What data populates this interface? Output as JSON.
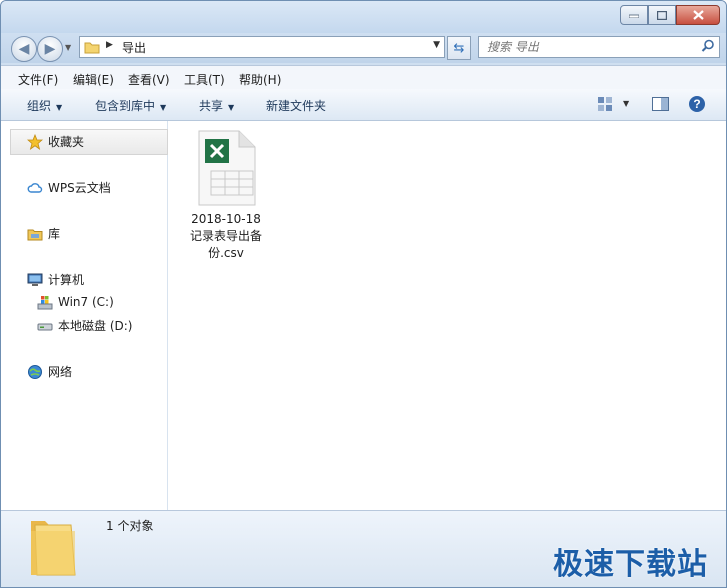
{
  "address": {
    "path": "导出"
  },
  "search": {
    "placeholder": "搜索 导出"
  },
  "menu": {
    "file": "文件(F)",
    "edit": "编辑(E)",
    "view": "查看(V)",
    "tools": "工具(T)",
    "help": "帮助(H)"
  },
  "toolbar": {
    "organize": "组织",
    "include_library": "包含到库中",
    "share": "共享",
    "new_folder": "新建文件夹"
  },
  "sidebar": {
    "favorites": "收藏夹",
    "wps_cloud": "WPS云文档",
    "libraries": "库",
    "computer": "计算机",
    "drive_c": "Win7 (C:)",
    "drive_d": "本地磁盘 (D:)",
    "network": "网络"
  },
  "files": [
    {
      "name_line1": "2018-10-18",
      "name_line2": "记录表导出备",
      "name_line3": "份.csv",
      "icon": "excel-csv-icon"
    }
  ],
  "details": {
    "count": "1 个对象"
  },
  "watermark": "极速下载站",
  "colors": {
    "excel_green": "#217346",
    "window_frame": "#cfdff0",
    "accent": "#1c5ea8"
  }
}
